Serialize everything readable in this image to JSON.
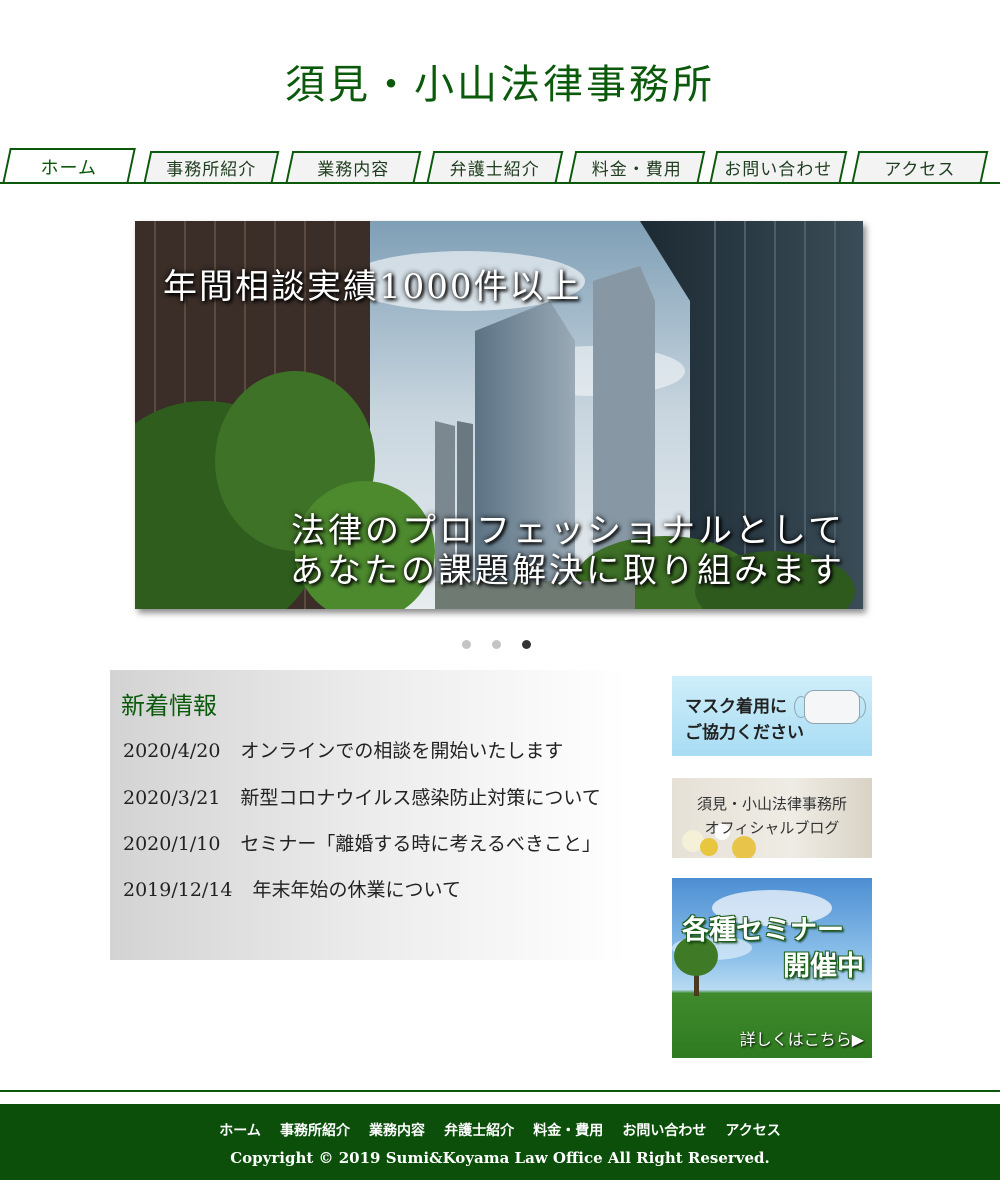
{
  "site": {
    "title": "須見・小山法律事務所"
  },
  "nav": {
    "items": [
      {
        "label": "ホーム",
        "active": true
      },
      {
        "label": "事務所紹介"
      },
      {
        "label": "業務内容"
      },
      {
        "label": "弁護士紹介"
      },
      {
        "label": "料金・費用"
      },
      {
        "label": "お問い合わせ"
      },
      {
        "label": "アクセス"
      }
    ]
  },
  "hero": {
    "top_text": "年間相談実績1000件以上",
    "bottom_line1": "法律のプロフェッショナルとして",
    "bottom_line2": "あなたの課題解決に取り組みます",
    "slide_count": 3,
    "active_slide": 3
  },
  "news": {
    "title": "新着情報",
    "items": [
      {
        "date": "2020/4/20",
        "text": "オンラインでの相談を開始いたします"
      },
      {
        "date": "2020/3/21",
        "text": "新型コロナウイルス感染防止対策について"
      },
      {
        "date": "2020/1/10",
        "text": "セミナー「離婚する時に考えるべきこと」"
      },
      {
        "date": "2019/12/14",
        "text": "年末年始の休業について"
      }
    ]
  },
  "banners": {
    "mask": {
      "line1": "マスク着用に",
      "line2": "ご協力ください"
    },
    "blog": {
      "line1": "須見・小山法律事務所",
      "line2": "オフィシャルブログ"
    },
    "seminar": {
      "line1": "各種セミナー",
      "line2": "開催中",
      "more": "詳しくはこちら▶"
    }
  },
  "footer": {
    "links": [
      "ホーム",
      "事務所紹介",
      "業務内容",
      "弁護士紹介",
      "料金・費用",
      "お問い合わせ",
      "アクセス"
    ],
    "copyright": "Copyright © 2019 Sumi&Koyama Law Office  All Right Reserved."
  },
  "colors": {
    "brand_green": "#0b5a0b",
    "footer_green": "#0b4f0b"
  }
}
